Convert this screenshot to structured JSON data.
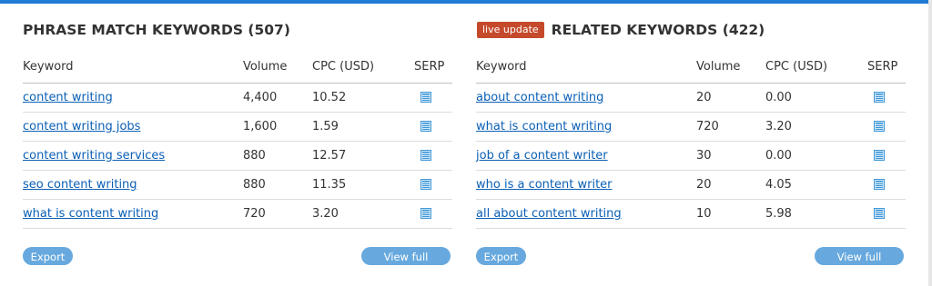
{
  "colors": {
    "accent": "#1f7bd3",
    "link": "#0a5fb5",
    "badge": "#c54a2c",
    "button": "#67a9de"
  },
  "columns": {
    "keyword": "Keyword",
    "volume": "Volume",
    "cpc": "CPC (USD)",
    "serp": "SERP"
  },
  "phrase": {
    "title": "PHRASE MATCH KEYWORDS (507)",
    "rows": [
      {
        "keyword": "content writing",
        "volume": "4,400",
        "cpc": "10.52"
      },
      {
        "keyword": "content writing jobs",
        "volume": "1,600",
        "cpc": "1.59"
      },
      {
        "keyword": "content writing services",
        "volume": "880",
        "cpc": "12.57"
      },
      {
        "keyword": "seo content writing",
        "volume": "880",
        "cpc": "11.35"
      },
      {
        "keyword": "what is content writing",
        "volume": "720",
        "cpc": "3.20"
      }
    ],
    "export_label": "Export",
    "full_report_label": "View full report"
  },
  "related": {
    "badge": "live update",
    "title": "RELATED KEYWORDS (422)",
    "rows": [
      {
        "keyword": "about content writing",
        "volume": "20",
        "cpc": "0.00"
      },
      {
        "keyword": "what is content writing",
        "volume": "720",
        "cpc": "3.20"
      },
      {
        "keyword": "job of a content writer",
        "volume": "30",
        "cpc": "0.00"
      },
      {
        "keyword": "who is a content writer",
        "volume": "20",
        "cpc": "4.05"
      },
      {
        "keyword": "all about content writing",
        "volume": "10",
        "cpc": "5.98"
      }
    ],
    "export_label": "Export",
    "full_report_label": "View full report"
  },
  "icons": {
    "serp": "serp-icon"
  }
}
